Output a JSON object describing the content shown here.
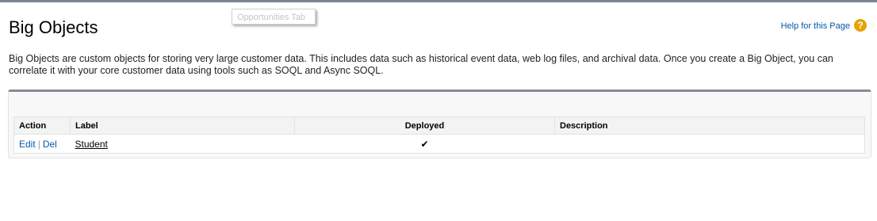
{
  "tooltip": {
    "text": "Opportunities Tab"
  },
  "header": {
    "title": "Big Objects",
    "help_label": "Help for this Page",
    "help_icon": "question-icon",
    "help_icon_glyph": "?"
  },
  "intro": {
    "text": "Big Objects are custom objects for storing very large customer data. This includes data such as historical event data, web log files, and archival data. Once you create a Big Object, you can correlate it with your core customer data using tools such as SOQL and Async SOQL."
  },
  "table": {
    "columns": {
      "action": "Action",
      "label": "Label",
      "deployed": "Deployed",
      "description": "Description"
    },
    "rows": [
      {
        "edit": "Edit",
        "separator": "|",
        "del": "Del",
        "label": "Student",
        "deployed": "✔",
        "description": ""
      }
    ]
  },
  "colors": {
    "link": "#015ba7",
    "panel_top_border": "#878a99",
    "help_icon": "#e8a200"
  }
}
